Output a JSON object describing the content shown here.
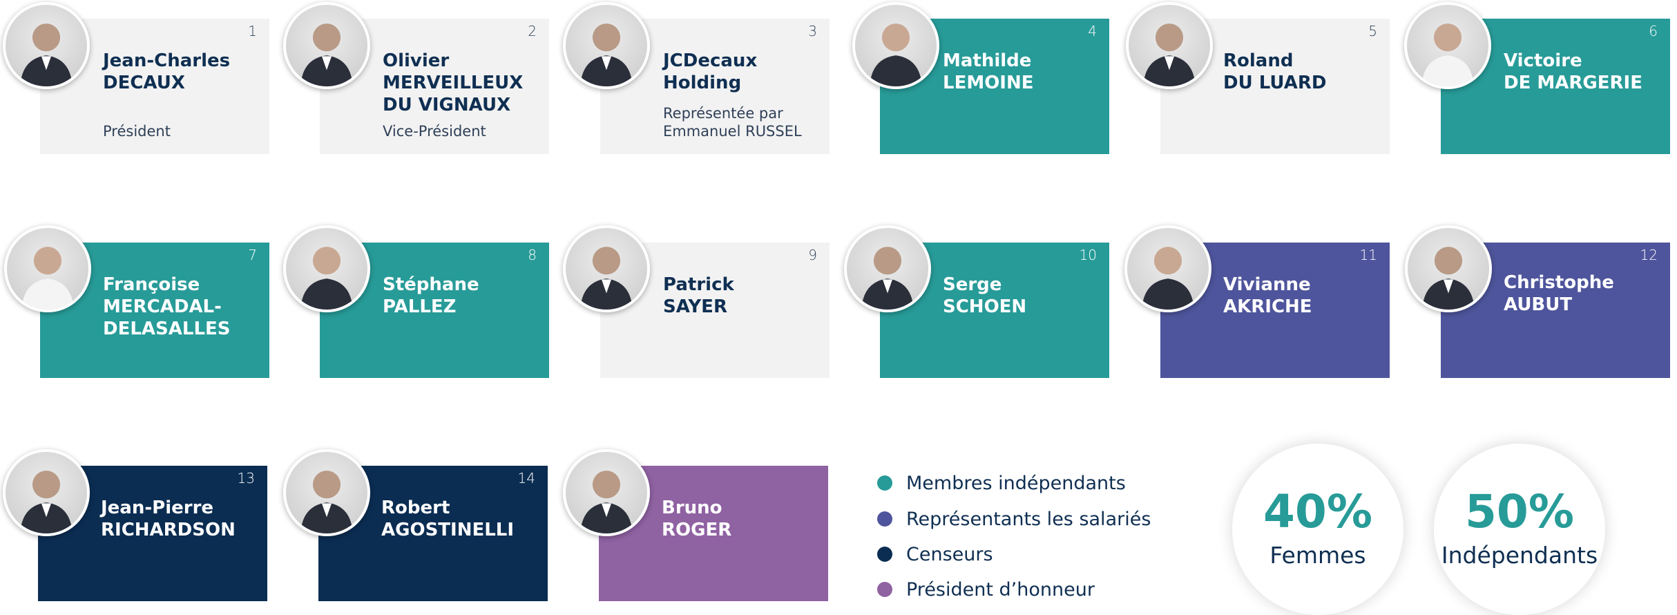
{
  "members": [
    {
      "number": "1",
      "name": "Jean-Charles\nDECAUX",
      "role": "Président",
      "category": "grey"
    },
    {
      "number": "2",
      "name": "Olivier\nMERVEILLEUX\nDU VIGNAUX",
      "role": "Vice-Président",
      "category": "grey"
    },
    {
      "number": "3",
      "name": "JCDecaux\nHolding",
      "role": "Représentée par\nEmmanuel RUSSEL",
      "category": "grey"
    },
    {
      "number": "4",
      "name": "Mathilde\nLEMOINE",
      "role": "",
      "category": "teal"
    },
    {
      "number": "5",
      "name": "Roland\nDU LUARD",
      "role": "",
      "category": "grey"
    },
    {
      "number": "6",
      "name": "Victoire\nDE MARGERIE",
      "role": "",
      "category": "teal"
    },
    {
      "number": "7",
      "name": "Françoise\nMERCADAL-\nDELASALLES",
      "role": "",
      "category": "teal"
    },
    {
      "number": "8",
      "name": "Stéphane\nPALLEZ",
      "role": "",
      "category": "teal"
    },
    {
      "number": "9",
      "name": "Patrick\nSAYER",
      "role": "",
      "category": "grey"
    },
    {
      "number": "10",
      "name": "Serge\nSCHOEN",
      "role": "",
      "category": "teal"
    },
    {
      "number": "11",
      "name": "Vivianne\nAKRICHE",
      "role": "",
      "category": "purple"
    },
    {
      "number": "12",
      "name": "Christophe\nAUBUT",
      "role": "",
      "category": "purple"
    },
    {
      "number": "13",
      "name": "Jean-Pierre\nRICHARDSON",
      "role": "",
      "category": "navy"
    },
    {
      "number": "14",
      "name": "Robert\nAGOSTINELLI",
      "role": "",
      "category": "navy"
    },
    {
      "number": "",
      "name": "Bruno\nROGER",
      "role": "",
      "category": "mauve"
    }
  ],
  "legend": [
    {
      "label": "Membres indépendants",
      "color": "#279b98"
    },
    {
      "label": "Représentants les salariés",
      "color": "#4e559c"
    },
    {
      "label": "Censeurs",
      "color": "#0b2d52"
    },
    {
      "label": "Président d’honneur",
      "color": "#8f62a2"
    }
  ],
  "stats": [
    {
      "value": "40%",
      "label": "Femmes"
    },
    {
      "value": "50%",
      "label": "Indépendants"
    }
  ],
  "colors": {
    "teal": "#279b98",
    "purple": "#4e559c",
    "navy": "#0b2d52",
    "mauve": "#8f62a2",
    "grey": "#f2f2f2",
    "text_dark": "#0f2f52"
  }
}
